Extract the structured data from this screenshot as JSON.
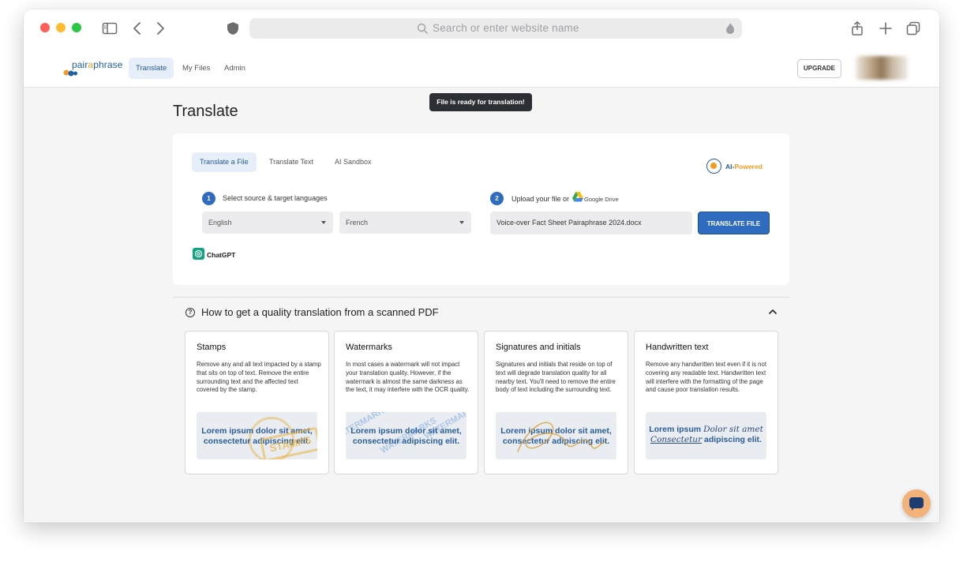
{
  "browser": {
    "url_placeholder": "Search or enter website name"
  },
  "app": {
    "logo_text_prefix": "pair",
    "logo_text_accent": "a",
    "logo_text_suffix": "phrase",
    "nav": [
      {
        "label": "Translate",
        "active": true
      },
      {
        "label": "My Files",
        "active": false
      },
      {
        "label": "Admin",
        "active": false
      }
    ],
    "upgrade_label": "UPGRADE"
  },
  "toast": "File is ready for translation!",
  "page_title": "Translate",
  "card": {
    "tabs": [
      {
        "label": "Translate a File",
        "active": true
      },
      {
        "label": "Translate Text",
        "active": false
      },
      {
        "label": "AI Sandbox",
        "active": false
      }
    ],
    "ai_badge": {
      "prefix": "AI-",
      "suffix": "Powered"
    },
    "step1": {
      "number": "1",
      "label": "Select source & target languages"
    },
    "step2": {
      "number": "2",
      "label": "Upload your file or",
      "drive_label": "Google Drive"
    },
    "source_language": "English",
    "target_language": "French",
    "file_name": "Voice-over Fact Sheet Pairaphrase 2024.docx",
    "translate_button": "TRANSLATE FILE",
    "engine_label": "ChatGPT"
  },
  "help": {
    "title": "How to get a quality translation from a scanned PDF",
    "icon": "?",
    "cards": [
      {
        "title": "Stamps",
        "body": "Remove any and all text impacted by a stamp that sits on top of text. Remove the entire surrounding text and the affected text covered by the stamp.",
        "sample": "Lorem ipsum dolor sit amet, consectetur adipiscing elit.",
        "overlay": "STAMPS"
      },
      {
        "title": "Watermarks",
        "body": "In most cases a watermark will not impact your translation quality. However, if the watermark is almost the same darkness as the text, it may interfere with the OCR quality.",
        "sample": "Lorem ipsum dolor sit amet, consectetur adipiscing elit.",
        "overlay": "WATERMARKS"
      },
      {
        "title": "Signatures and initials",
        "body": "Signatures and initials that reside on top of text will degrade translation quality for all nearby text. You'll need to remove the entire body of text including the surrounding text.",
        "sample": "Lorem ipsum dolor sit amet, consectetur adipiscing elit."
      },
      {
        "title": "Handwritten text",
        "body": "Remove any handwritten text even if it is not covering any readable text. Handwritten text will interfere with the formatting of the page and cause poor translation results.",
        "sample_a": "Lorem ipsum",
        "sample_hw1": "Dolor sit amet",
        "sample_hw2": "Consectetur",
        "sample_b": "adipiscing elit."
      }
    ]
  },
  "colors": {
    "accent": "#2f6cc0",
    "brand_orange": "#f39c21",
    "nav_active_bg": "#e5eef9"
  }
}
